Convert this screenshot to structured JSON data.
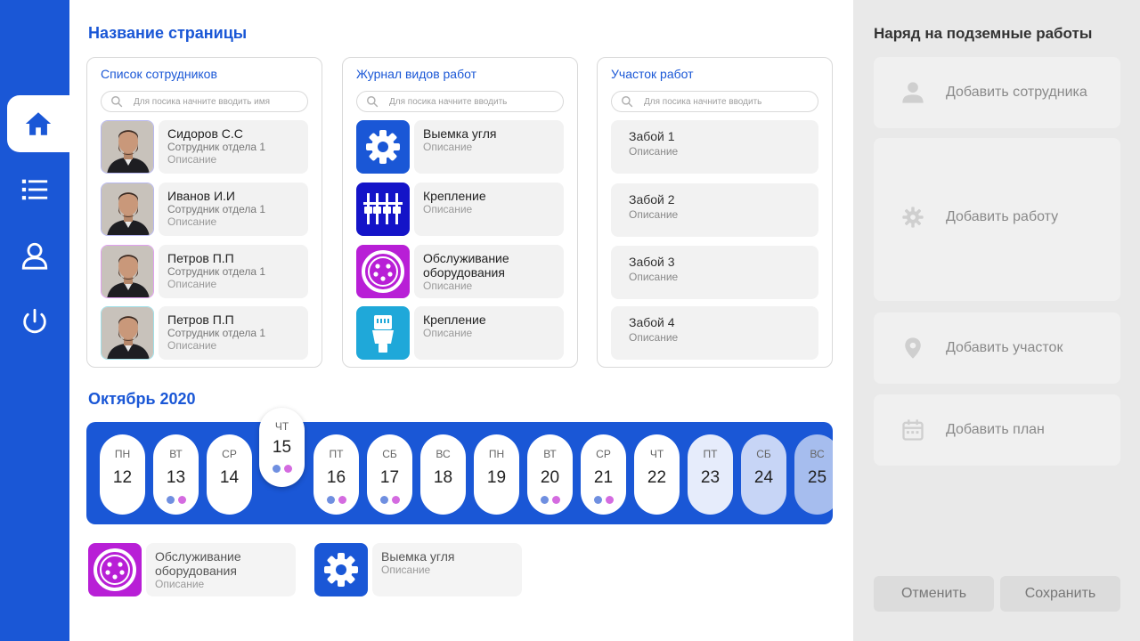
{
  "page": {
    "title": "Название страницы"
  },
  "employees": {
    "title": "Список сотрудников",
    "search_placeholder": "Для посика начните вводить имя",
    "items": [
      {
        "name": "Сидоров С.С",
        "role": "Сотрудник отдела 1",
        "desc": "Описание"
      },
      {
        "name": "Иванов И.И",
        "role": "Сотрудник отдела 1",
        "desc": "Описание"
      },
      {
        "name": "Петров П.П",
        "role": "Сотрудник отдела 1",
        "desc": "Описание"
      },
      {
        "name": "Петров П.П",
        "role": "Сотрудник отдела 1",
        "desc": "Описание"
      }
    ]
  },
  "works": {
    "title": "Журнал видов работ",
    "search_placeholder": "Для посика начните вводить",
    "items": [
      {
        "name": "Выемка угля",
        "desc": "Описание",
        "icon": "gear-icon",
        "color": "#1a57d6"
      },
      {
        "name": "Крепление",
        "desc": "Описание",
        "icon": "connectors-icon",
        "color": "#1414c8"
      },
      {
        "name": "Обслуживание оборудования",
        "desc": "Описание",
        "icon": "socket-icon",
        "color": "#b81fd6"
      },
      {
        "name": "Крепление",
        "desc": "Описание",
        "icon": "plug-icon",
        "color": "#1fa8d9"
      }
    ]
  },
  "zones": {
    "title": "Участок работ",
    "search_placeholder": "Для посика начните вводить",
    "items": [
      {
        "name": "Забой 1",
        "desc": "Описание"
      },
      {
        "name": "Забой 2",
        "desc": "Описание"
      },
      {
        "name": "Забой 3",
        "desc": "Описание"
      },
      {
        "name": "Забой 4",
        "desc": "Описание"
      }
    ]
  },
  "calendar": {
    "month": "Октябрь 2020",
    "days": [
      {
        "dn": "ПН",
        "dd": "12",
        "dots": false
      },
      {
        "dn": "ВТ",
        "dd": "13",
        "dots": true
      },
      {
        "dn": "СР",
        "dd": "14",
        "dots": false
      },
      {
        "dn": "ЧТ",
        "dd": "15",
        "dots": true,
        "selected": true
      },
      {
        "dn": "ПТ",
        "dd": "16",
        "dots": true
      },
      {
        "dn": "СБ",
        "dd": "17",
        "dots": true
      },
      {
        "dn": "ВС",
        "dd": "18",
        "dots": false
      },
      {
        "dn": "ПН",
        "dd": "19",
        "dots": false
      },
      {
        "dn": "ВТ",
        "dd": "20",
        "dots": true
      },
      {
        "dn": "СР",
        "dd": "21",
        "dots": true
      },
      {
        "dn": "ЧТ",
        "dd": "22",
        "dots": false
      },
      {
        "dn": "ПТ",
        "dd": "23",
        "dots": false
      },
      {
        "dn": "СБ",
        "dd": "24",
        "dots": false
      },
      {
        "dn": "ВС",
        "dd": "25",
        "dots": false
      }
    ],
    "dot_colors": [
      "#6f8fe0",
      "#d46be0"
    ]
  },
  "selected_works": [
    {
      "name": "Обслуживание оборудования",
      "desc": "Описание"
    },
    {
      "name": "Выемка угля",
      "desc": "Описание"
    }
  ],
  "order": {
    "title": "Наряд на подземные работы",
    "add_employee": "Добавить сотрудника",
    "add_work": "Добавить работу",
    "add_zone": "Добавить участок",
    "add_plan": "Добавить план",
    "cancel": "Отменить",
    "save": "Сохранить"
  },
  "colors": {
    "accent": "#1a57d6",
    "panel": "#e9e9e9"
  }
}
